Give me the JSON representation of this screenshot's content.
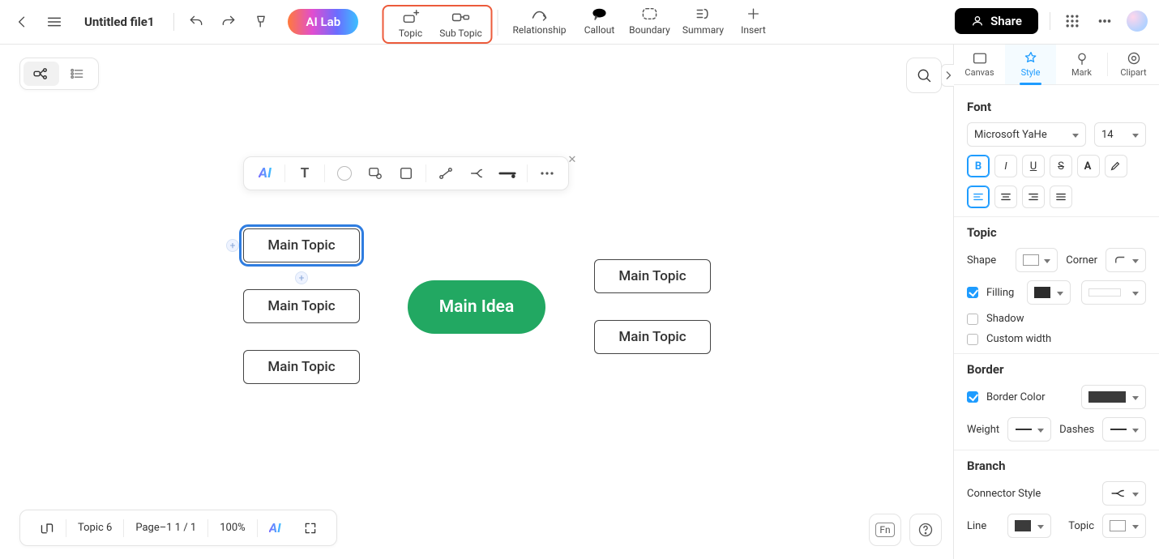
{
  "header": {
    "file_name": "Untitled file1",
    "ai_lab": "AI Lab",
    "tools": {
      "topic": "Topic",
      "sub_topic": "Sub Topic",
      "relationship": "Relationship",
      "callout": "Callout",
      "boundary": "Boundary",
      "summary": "Summary",
      "insert": "Insert"
    },
    "share": "Share"
  },
  "mindmap": {
    "center": "Main Idea",
    "left_topics": [
      "Main Topic",
      "Main Topic",
      "Main Topic"
    ],
    "right_topics": [
      "Main Topic",
      "Main Topic"
    ],
    "selected_left_index": 0
  },
  "right_panel": {
    "tabs": {
      "canvas": "Canvas",
      "style": "Style",
      "mark": "Mark",
      "clipart": "Clipart"
    },
    "active_tab": "style",
    "font": {
      "section": "Font",
      "family": "Microsoft YaHe",
      "size": "14",
      "bold_active": true,
      "align_active": "left"
    },
    "topic": {
      "section": "Topic",
      "shape_label": "Shape",
      "corner_label": "Corner",
      "filling_label": "Filling",
      "filling_checked": true,
      "filling_color": "#2c2c2c",
      "shadow_label": "Shadow",
      "shadow_checked": false,
      "custom_width_label": "Custom width",
      "custom_width_checked": false
    },
    "border": {
      "section": "Border",
      "color_label": "Border Color",
      "color_checked": true,
      "color_value": "#3b3b3b",
      "weight_label": "Weight",
      "dashes_label": "Dashes"
    },
    "branch": {
      "section": "Branch",
      "connector_label": "Connector Style",
      "line_label": "Line",
      "topic_label": "Topic"
    }
  },
  "footer": {
    "topic_count": "Topic 6",
    "page": "Page–1  1 / 1",
    "zoom": "100%",
    "fn": "Fn"
  }
}
